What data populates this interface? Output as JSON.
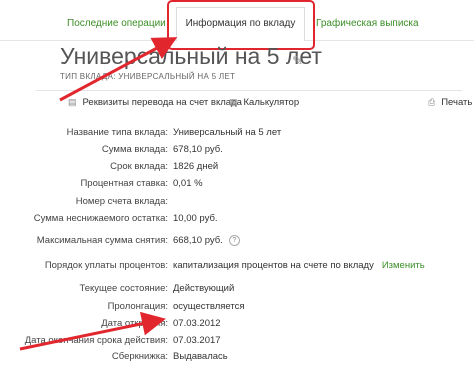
{
  "tabs": {
    "recent_ops": "Последние операции",
    "deposit_info": "Информация по вкладу",
    "graphic_statement": "Графическая выписка"
  },
  "deposit": {
    "title": "Универсальный на 5 лет",
    "type_line": "ТИП ВКЛАДА: УНИВЕРСАЛЬНЫЙ НА 5 ЛЕТ"
  },
  "actions": {
    "transfer_details": "Реквизиты перевода на счет вклада",
    "calculator": "Калькулятор",
    "print": "Печать"
  },
  "details": {
    "type_name": {
      "label": "Название типа вклада:",
      "value": "Универсальный на 5 лет"
    },
    "amount": {
      "label": "Сумма вклада:",
      "value": "678,10 руб."
    },
    "term": {
      "label": "Срок вклада:",
      "value": "1826 дней"
    },
    "rate": {
      "label": "Процентная ставка:",
      "value": "0,01 %"
    },
    "account": {
      "label": "Номер счета вклада:",
      "value": ""
    },
    "min_balance": {
      "label": "Сумма неснижаемого остатка:",
      "value": "10,00 руб."
    },
    "max_withdraw": {
      "label": "Максимальная сумма снятия:",
      "value": "668,10 руб."
    },
    "interest": {
      "label": "Порядок уплаты процентов:",
      "value": "капитализация процентов на счете по вкладу",
      "change": "Изменить"
    },
    "state": {
      "label": "Текущее состояние:",
      "value": "Действующий"
    },
    "prolongation": {
      "label": "Пролонгация:",
      "value": "осуществляется"
    },
    "open_date": {
      "label": "Дата открытия:",
      "value": "07.03.2012"
    },
    "end_date": {
      "label": "Дата окончания срока действия:",
      "value": "07.03.2017"
    },
    "passbook": {
      "label": "Сберкнижка:",
      "value": "Выдавалась"
    }
  },
  "colors": {
    "accent_green": "#3b8f27",
    "annotation_red": "#e2262e"
  }
}
